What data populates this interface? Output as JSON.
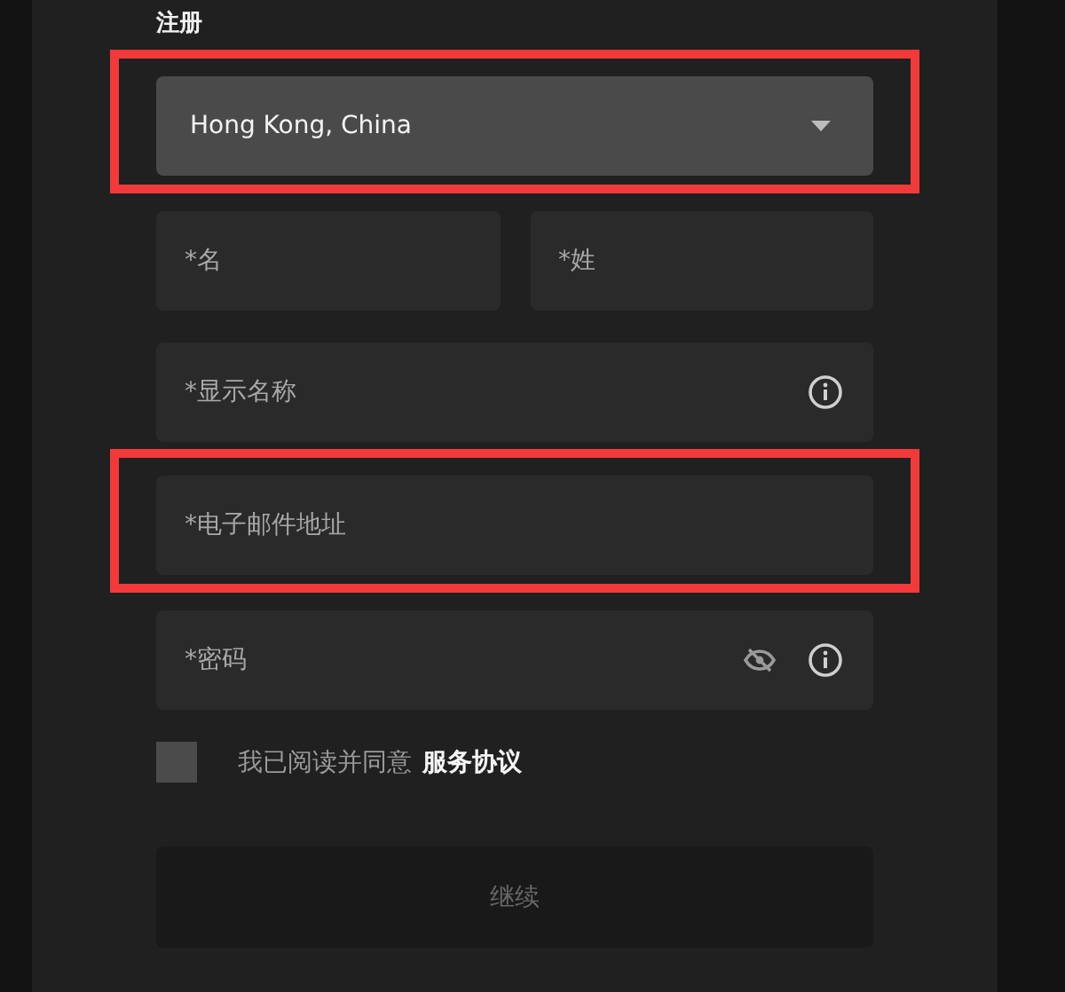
{
  "title": "注册",
  "region": {
    "value": "Hong Kong, China",
    "highlighted": true
  },
  "name_fields": [
    {
      "placeholder": "*名"
    },
    {
      "placeholder": "*姓"
    }
  ],
  "fields": [
    {
      "placeholder": "*显示名称",
      "highlighted": false,
      "visibility_toggle": false,
      "info": true
    },
    {
      "placeholder": "*电子邮件地址",
      "highlighted": true,
      "visibility_toggle": false,
      "info": false
    },
    {
      "placeholder": "*密码",
      "highlighted": false,
      "visibility_toggle": true,
      "info": true
    }
  ],
  "agreement": {
    "checked": false,
    "label": "我已阅读并同意",
    "link": "服务协议"
  },
  "submit": {
    "label": "继续",
    "disabled": true
  }
}
